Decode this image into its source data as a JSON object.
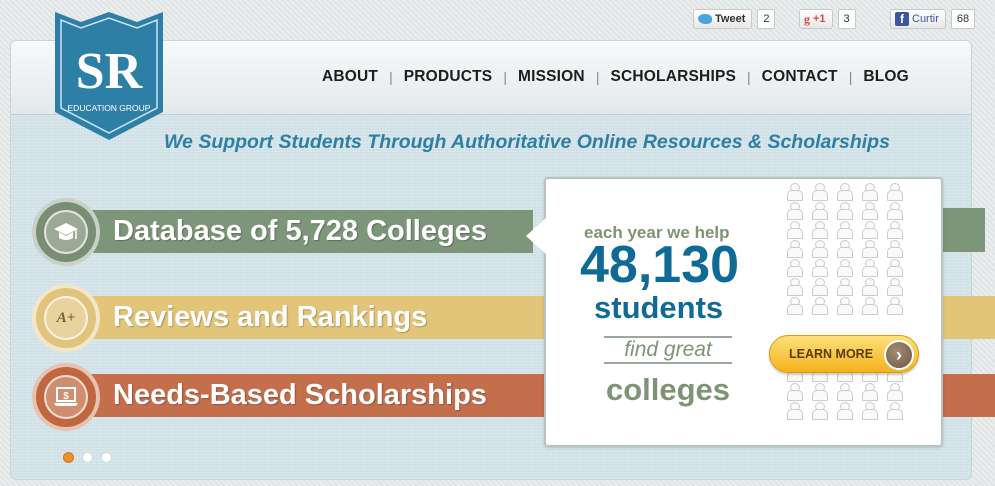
{
  "social": {
    "tweet_label": "Tweet",
    "tweet_count": "2",
    "gplus_label": "+1",
    "gplus_count": "3",
    "fb_label": "Curtir",
    "fb_count": "68"
  },
  "logo": {
    "letters": "SR",
    "subtitle": "EDUCATION GROUP",
    "colors": {
      "shield": "#2e7fa6",
      "shield_dark": "#1f6388"
    }
  },
  "nav": {
    "items": [
      "ABOUT",
      "PRODUCTS",
      "MISSION",
      "SCHOLARSHIPS",
      "CONTACT",
      "BLOG"
    ]
  },
  "tagline": "We Support Students Through Authoritative Online Resources & Scholarships",
  "features": [
    {
      "label": "Database of 5,728 Colleges",
      "icon": "graduation-cap-icon",
      "color": "#7d9578"
    },
    {
      "label": "Reviews and Rankings",
      "icon": "a-plus-grade-icon",
      "color": "#e3c57a"
    },
    {
      "label": "Needs-Based Scholarships",
      "icon": "laptop-dollar-icon",
      "color": "#c46e4c"
    }
  ],
  "callout": {
    "each_year": "each year we help",
    "number": "48,130",
    "students": "students",
    "find_great": "find great",
    "colleges": "colleges",
    "learn_more": "LEARN MORE",
    "person_icon_name": "person-icon"
  },
  "carousel": {
    "slides": 3,
    "active": 1
  },
  "colors": {
    "brand_blue": "#0f6b96",
    "tagline_blue": "#2f7ea3",
    "green": "#7d9578",
    "gold": "#e3c57a",
    "rust": "#c46e4c",
    "button_orange": "#f4b21d"
  }
}
